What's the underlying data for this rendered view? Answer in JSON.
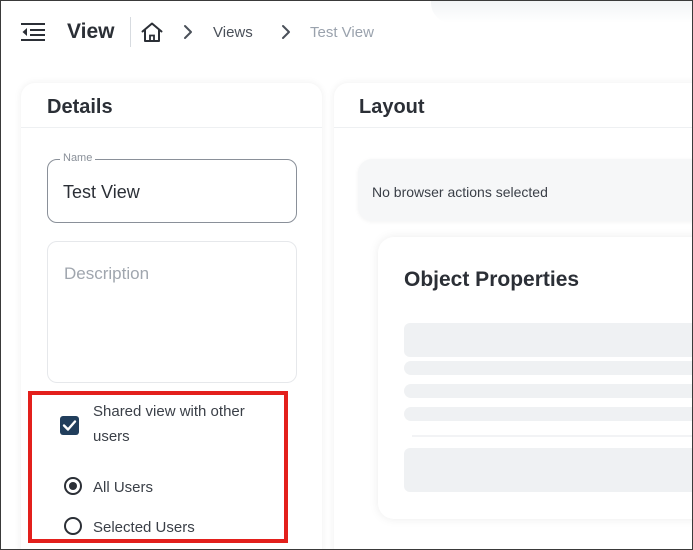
{
  "header": {
    "title": "View",
    "breadcrumb": {
      "home_icon": "home-icon",
      "items": [
        "Views",
        "Test View"
      ]
    },
    "menu_icon": "menu-collapse-icon"
  },
  "details": {
    "title": "Details",
    "name_field": {
      "label": "Name",
      "value": "Test View"
    },
    "description_field": {
      "placeholder": "Description",
      "value": ""
    },
    "share": {
      "checkbox_label_line1": "Shared view with other",
      "checkbox_label_line2": "users",
      "checked": true,
      "options": [
        {
          "label": "All Users",
          "selected": true
        },
        {
          "label": "Selected Users",
          "selected": false
        }
      ]
    }
  },
  "layout": {
    "title": "Layout",
    "actions_text": "No browser actions selected",
    "object_card": {
      "title": "Object Properties"
    }
  },
  "colors": {
    "highlight": "#e3201c",
    "checkbox": "#213e5c",
    "text_dark": "#2b2f36"
  }
}
